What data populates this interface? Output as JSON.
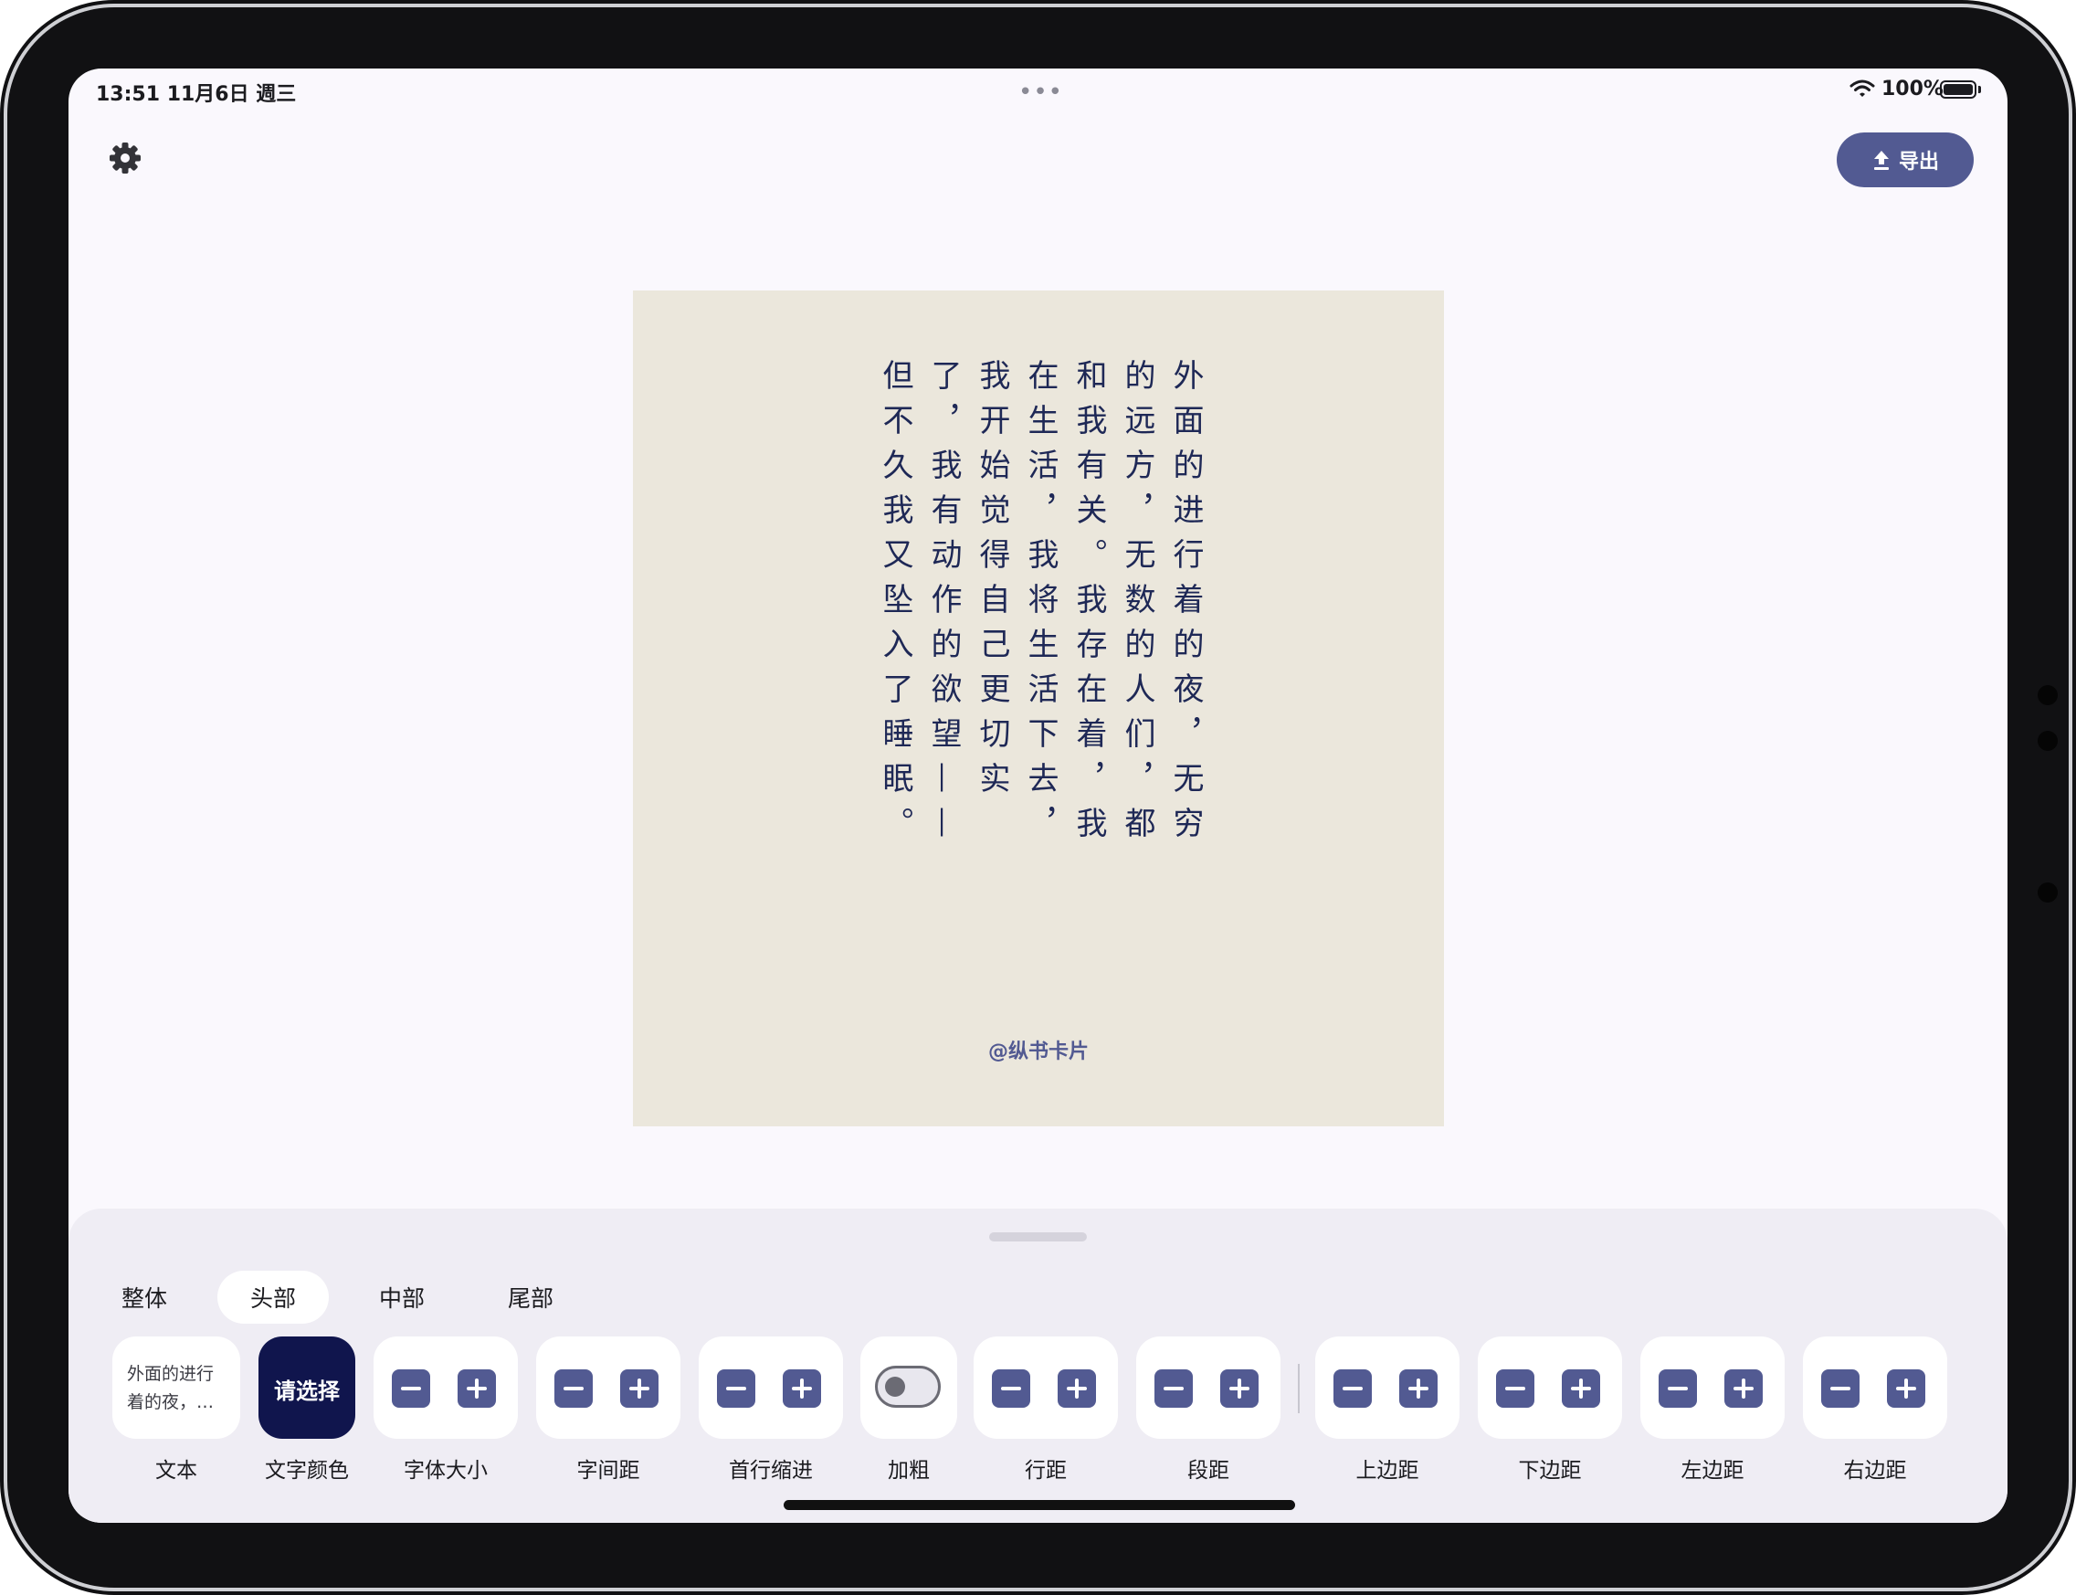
{
  "status_bar": {
    "time": "13:51  11月6日 週三",
    "multitask_dots": "•••",
    "battery_percent": "100%",
    "battery_level": 1.0
  },
  "toolbar": {
    "settings_icon": "gear-icon",
    "export_icon": "upload-icon",
    "export_label": "导出",
    "accent_color": "#525a92"
  },
  "card": {
    "background": "#ebe7dc",
    "text_color": "#1e2856",
    "body_text": "外面的进行着的夜，无穷的远方，无数的人们，都和我有关。我存在着，我在生活，我将生活下去，我开始觉得自己更切实了，我有动作的欲望——但不久我又坠入了睡眠。",
    "signature": "@纵书卡片"
  },
  "panel": {
    "tabs": [
      {
        "label": "整体",
        "active": false
      },
      {
        "label": "头部",
        "active": true
      },
      {
        "label": "中部",
        "active": false
      },
      {
        "label": "尾部",
        "active": false
      }
    ],
    "text_tool": {
      "preview": "外面的进行着的夜，…",
      "label": "文本"
    },
    "color_tool": {
      "button": "请选择",
      "label": "文字颜色",
      "swatch": "#10154d"
    },
    "steppers": {
      "font_size": "字体大小",
      "letter_spacing": "字间距",
      "first_indent": "首行缩进",
      "line_height": "行距",
      "paragraph_spacing": "段距",
      "margin_top": "上边距",
      "margin_bottom": "下边距",
      "margin_left": "左边距",
      "margin_right": "右边距"
    },
    "bold_tool": {
      "label": "加粗",
      "on": false
    }
  }
}
